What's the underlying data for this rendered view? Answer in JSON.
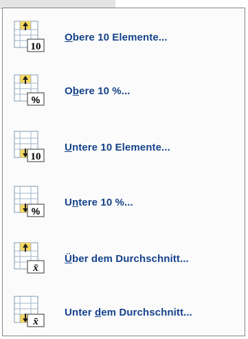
{
  "menu": {
    "items": [
      {
        "label": "Obere 10 Elemente...",
        "accel": "O",
        "rest": "bere 10 Elemente...",
        "pre": "",
        "icon": "top-10-items-icon",
        "badge": "10",
        "arrow": "up"
      },
      {
        "label": "Obere 10 %...",
        "pre": "O",
        "accel": "b",
        "rest": "ere 10 %...",
        "icon": "top-10-percent-icon",
        "badge": "%",
        "arrow": "up"
      },
      {
        "label": "Untere 10 Elemente...",
        "pre": "",
        "accel": "U",
        "rest": "ntere 10 Elemente...",
        "icon": "bottom-10-items-icon",
        "badge": "10",
        "arrow": "down"
      },
      {
        "label": "Untere 10 %...",
        "pre": "U",
        "accel": "n",
        "rest": "tere 10 %...",
        "icon": "bottom-10-percent-icon",
        "badge": "%",
        "arrow": "down"
      },
      {
        "label": "Über dem Durchschnitt...",
        "pre": "",
        "accel": "Ü",
        "rest": "ber dem Durchschnitt...",
        "icon": "above-average-icon",
        "badge": "x̄",
        "arrow": "up"
      },
      {
        "label": "Unter dem Durchschnitt...",
        "pre": "Unter ",
        "accel": "d",
        "rest": "em Durchschnitt...",
        "icon": "below-average-icon",
        "badge": "x̄",
        "arrow": "down"
      }
    ]
  },
  "colors": {
    "label": "#15428b",
    "highlight": "#f5d65c",
    "arrow": "#1e1e1e",
    "grid": "#9fb3c8"
  }
}
